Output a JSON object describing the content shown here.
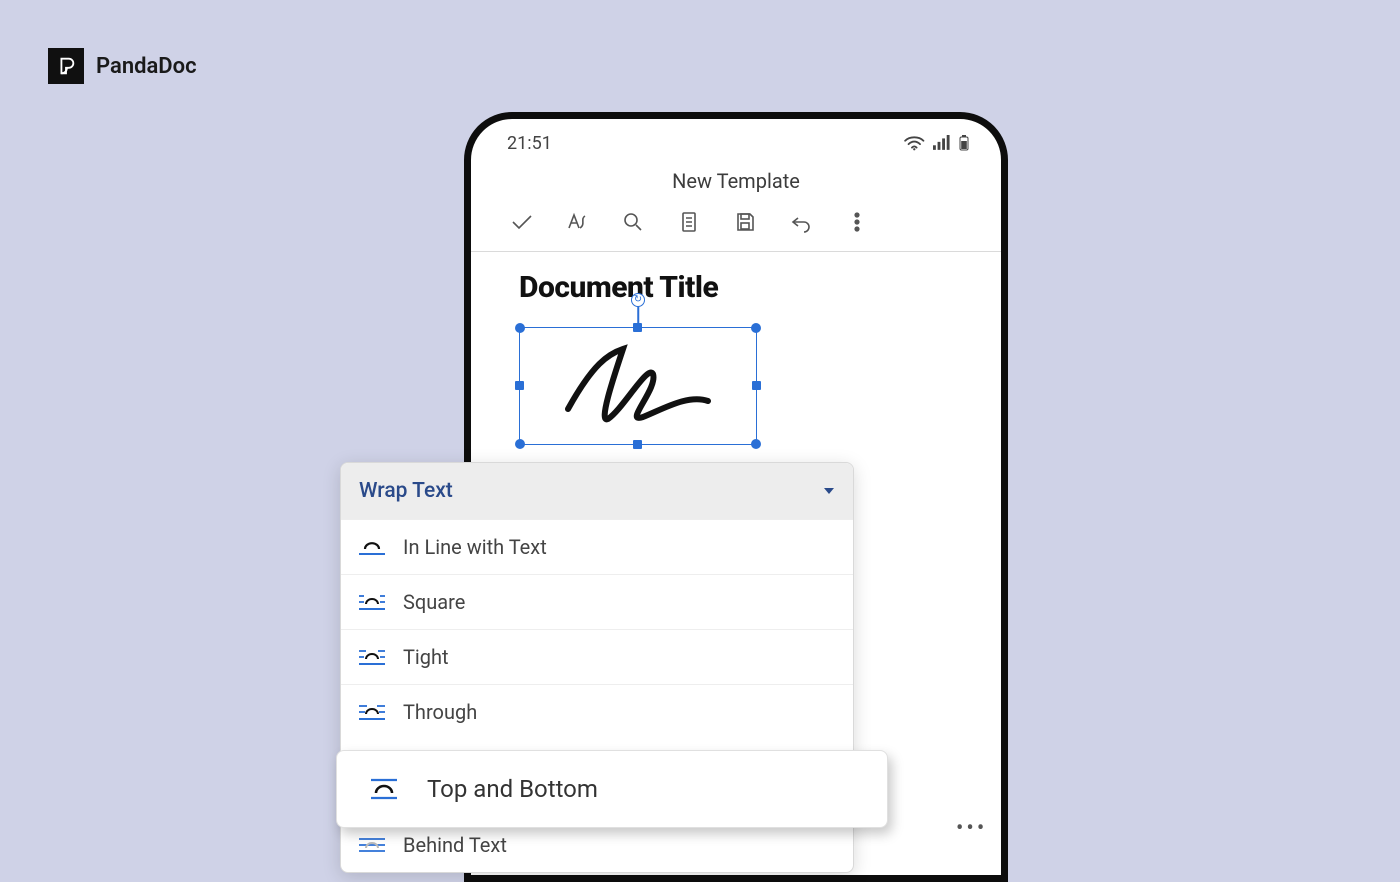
{
  "brand": {
    "name": "PandaDoc"
  },
  "status": {
    "time": "21:51"
  },
  "app": {
    "title": "New Template"
  },
  "toolbar": {
    "icons": [
      "check",
      "edit-text",
      "search",
      "page",
      "save",
      "undo",
      "more"
    ]
  },
  "document": {
    "title": "Document Title"
  },
  "popup": {
    "title": "Wrap Text",
    "items": [
      {
        "label": "In Line with Text"
      },
      {
        "label": "Square"
      },
      {
        "label": "Tight"
      },
      {
        "label": "Through"
      },
      {
        "label": "Top and Bottom",
        "selected": true
      },
      {
        "label": "Behind Text"
      }
    ]
  }
}
